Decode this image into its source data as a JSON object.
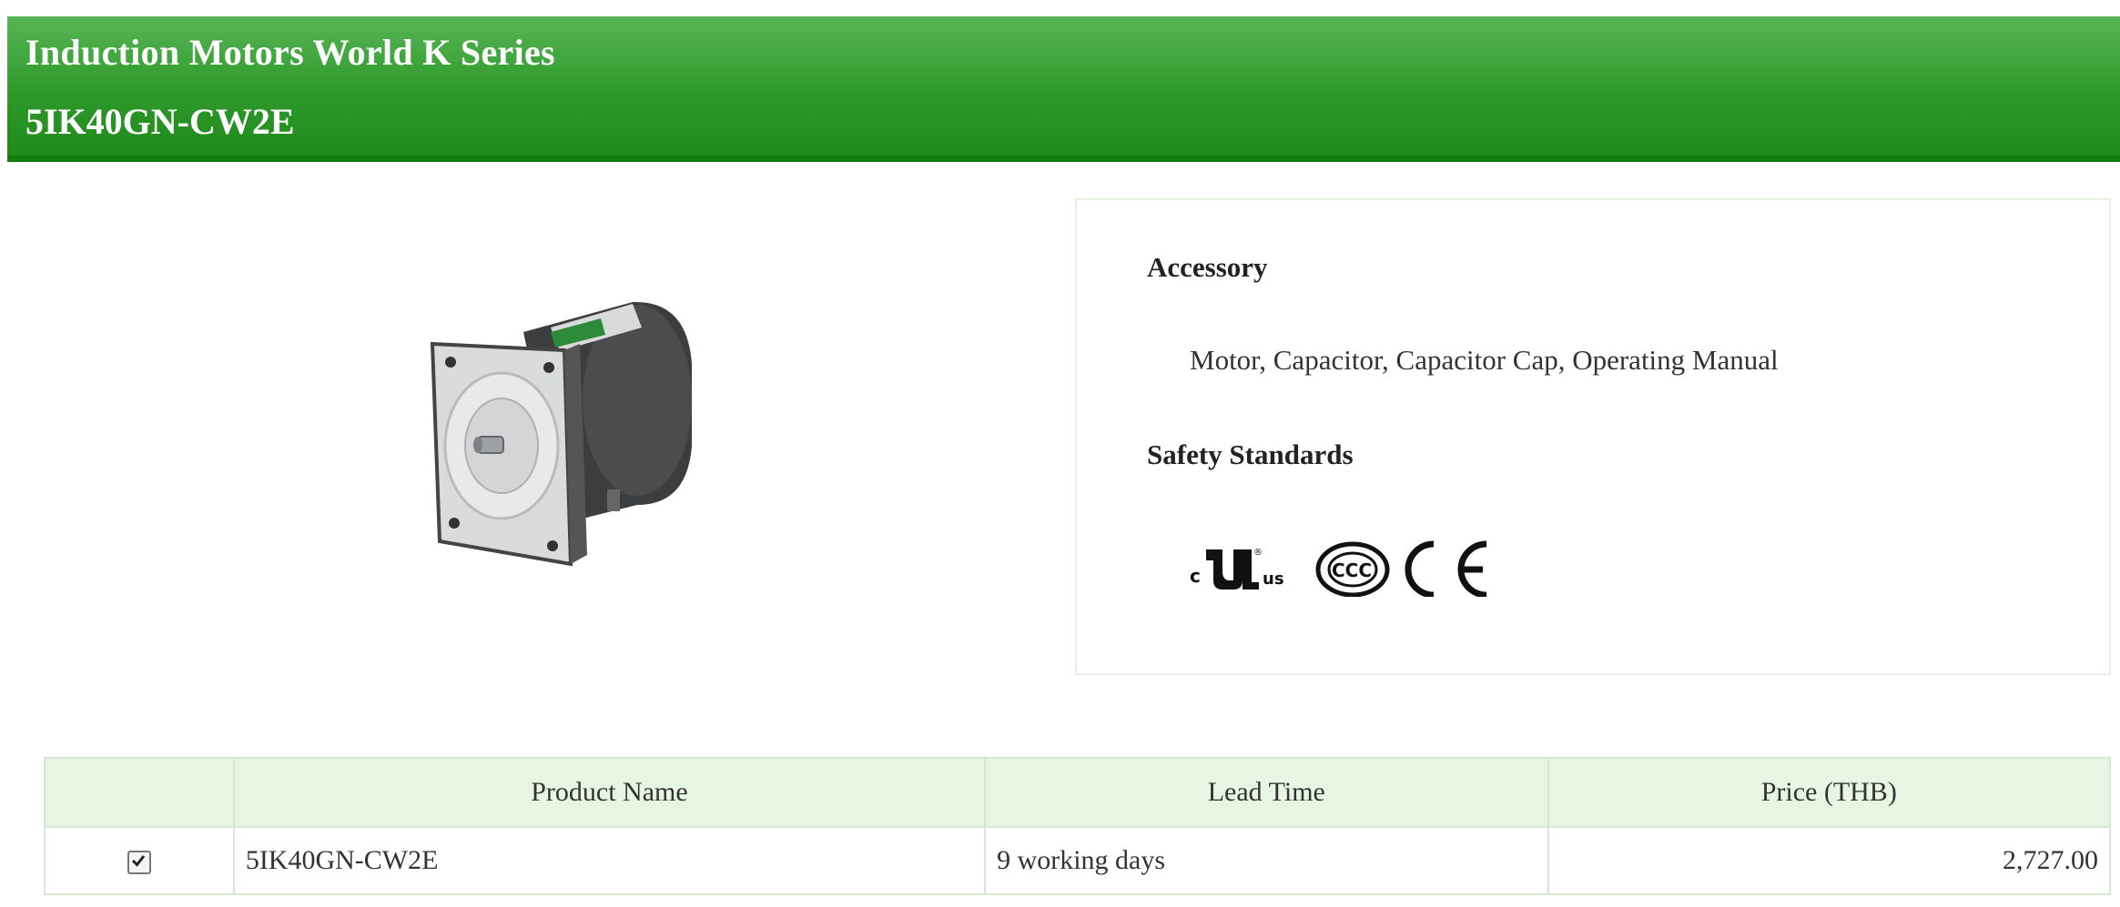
{
  "header": {
    "series": "Induction Motors World K Series",
    "model": "5IK40GN-CW2E"
  },
  "product_image": {
    "icon": "motor-product-image"
  },
  "info": {
    "accessory_heading": "Accessory",
    "accessory_text": "Motor, Capacitor, Capacitor Cap, Operating Manual",
    "safety_heading": "Safety Standards",
    "certifications": [
      "cURus",
      "CCC",
      "CE"
    ]
  },
  "table": {
    "headers": [
      "",
      "Product Name",
      "Lead Time",
      "Price (THB)"
    ],
    "rows": [
      {
        "selected": true,
        "product_name": "5IK40GN-CW2E",
        "lead_time": "9 working days",
        "price": "2,727.00"
      }
    ]
  },
  "colors": {
    "header_green": "#2f9a2b",
    "header_green_dark": "#137a10",
    "table_header_bg": "#e6f6e2",
    "border": "#d6e7d3"
  }
}
